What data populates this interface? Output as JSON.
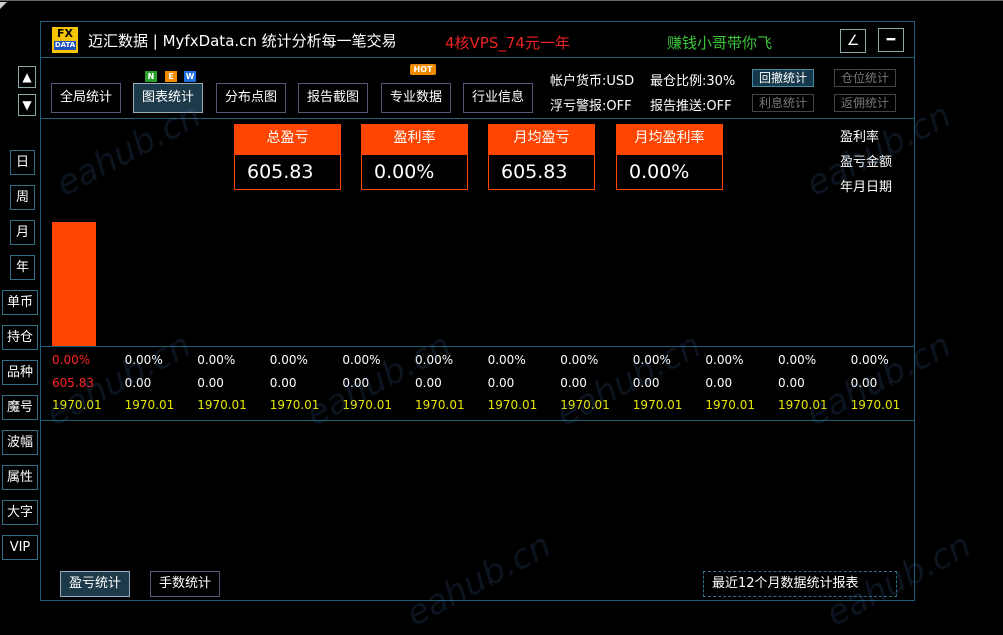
{
  "title": {
    "logo_top": "FX",
    "logo_bottom": "DATA",
    "main": "迈汇数据 | MyfxData.cn  统计分析每一笔交易",
    "ad": "4核VPS_74元一年",
    "slogan": "赚钱小哥带你飞",
    "edit_icon": "∠",
    "min_icon": "━"
  },
  "nav": {
    "up": "▲",
    "down": "▼",
    "tabs": [
      "全局统计",
      "图表统计",
      "分布点图",
      "报告截图",
      "专业数据",
      "行业信息"
    ],
    "new_badge": [
      "N",
      "E",
      "W"
    ],
    "hot_badge": "HOT"
  },
  "account": {
    "currency": "帐户货币:USD",
    "max_position": "最仓比例:30%",
    "float_alert": "浮亏警报:OFF",
    "report_push": "报告推送:OFF"
  },
  "side_buttons": {
    "drawdown": "回撤统计",
    "position": "仓位统计",
    "interest": "利息统计",
    "rebate": "返佣统计"
  },
  "period": [
    "日",
    "周",
    "月",
    "年"
  ],
  "side_menu": [
    "单币",
    "持仓",
    "品种",
    "魔号",
    "波幅",
    "属性",
    "大字",
    "VIP"
  ],
  "cards": [
    {
      "label": "总盈亏",
      "value": "605.83"
    },
    {
      "label": "盈利率",
      "value": "0.00%"
    },
    {
      "label": "月均盈亏",
      "value": "605.83"
    },
    {
      "label": "月均盈利率",
      "value": "0.00%"
    }
  ],
  "legend": [
    "盈利率",
    "盈亏金额",
    "年月日期"
  ],
  "colors": {
    "accent": "#ff4500",
    "date": "#e6e600",
    "negative": "#ff2222"
  },
  "chart_data": {
    "type": "bar",
    "categories": [
      "1970.01",
      "1970.01",
      "1970.01",
      "1970.01",
      "1970.01",
      "1970.01",
      "1970.01",
      "1970.01",
      "1970.01",
      "1970.01",
      "1970.01",
      "1970.01"
    ],
    "values": [
      605.83,
      0,
      0,
      0,
      0,
      0,
      0,
      0,
      0,
      0,
      0,
      0
    ],
    "rates": [
      "0.00%",
      "0.00%",
      "0.00%",
      "0.00%",
      "0.00%",
      "0.00%",
      "0.00%",
      "0.00%",
      "0.00%",
      "0.00%",
      "0.00%",
      "0.00%"
    ],
    "value_labels": [
      "605.83",
      "0.00",
      "0.00",
      "0.00",
      "0.00",
      "0.00",
      "0.00",
      "0.00",
      "0.00",
      "0.00",
      "0.00",
      "0.00"
    ]
  },
  "bottom": {
    "tab_pnl": "盈亏统计",
    "tab_lots": "手数统计",
    "report": "最近12个月数据统计报表"
  },
  "watermark": "eahub.cn"
}
